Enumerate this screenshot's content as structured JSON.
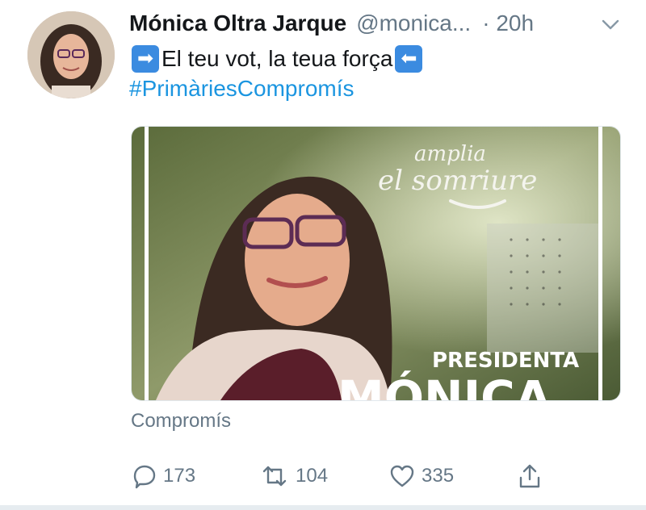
{
  "tweet": {
    "author_name": "Mónica Oltra Jarque",
    "handle": "@monica...",
    "time": "· 20h",
    "text_main": "El teu vot, la teua força",
    "emoji_left": "➡",
    "emoji_right": "⬅",
    "hashtag": "#PrimàriesCompromís",
    "media": {
      "overlay_script_line1": "amplia",
      "overlay_script_line2": "el somriure",
      "overlay_label": "PRESIDENTA",
      "overlay_name": "MÓNICA"
    },
    "source_label": "Compromís",
    "actions": {
      "replies": "173",
      "retweets": "104",
      "likes": "335"
    }
  },
  "colors": {
    "text_primary": "#14171a",
    "text_secondary": "#657786",
    "link": "#1b95e0",
    "emoji_bg": "#3b8be0"
  },
  "icons": [
    "chevron-down-icon",
    "reply-icon",
    "retweet-icon",
    "like-icon",
    "share-icon",
    "right-arrow-emoji-icon",
    "left-arrow-emoji-icon"
  ]
}
